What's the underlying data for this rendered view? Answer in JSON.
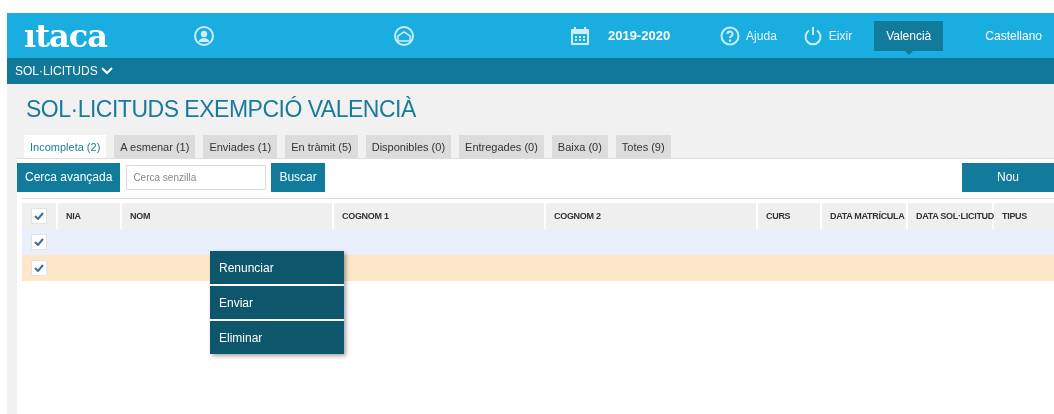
{
  "header": {
    "logo": "ıtaca",
    "year": "2019-2020",
    "help": "Ajuda",
    "exit": "Eixir",
    "languages": [
      {
        "label": "Valencià",
        "selected": true
      },
      {
        "label": "Castellano",
        "selected": false
      }
    ]
  },
  "subbar": {
    "menu": "SOL·LICITUDS"
  },
  "title": "SOL·LICITUDS EXEMPCIÓ VALENCIÀ",
  "tabs": [
    {
      "label": "Incompleta (2)",
      "selected": true
    },
    {
      "label": "A esmenar (1)",
      "selected": false
    },
    {
      "label": "Enviades (1)",
      "selected": false
    },
    {
      "label": "En tràmit (5)",
      "selected": false
    },
    {
      "label": "Disponibles (0)",
      "selected": false
    },
    {
      "label": "Entregades (0)",
      "selected": false
    },
    {
      "label": "Baixa (0)",
      "selected": false
    },
    {
      "label": "Totes (9)",
      "selected": false
    }
  ],
  "toolbar": {
    "advanced": "Cerca avançada",
    "search": {
      "placeholder": "Cerca senzilla"
    },
    "search_button": "Buscar",
    "new_button": "Nou"
  },
  "table": {
    "all_checked": true,
    "columns": [
      "NIA",
      "NOM",
      "COGNOM 1",
      "COGNOM 2",
      "CURS",
      "DATA MATRÍCULA",
      "DATA SOL·LICITUD",
      "TIPUS"
    ],
    "rows": [
      {
        "checked": true,
        "hovered": true,
        "selected": false
      },
      {
        "checked": true,
        "hovered": false,
        "selected": true
      }
    ]
  },
  "context_menu": [
    "Renunciar",
    "Enviar",
    "Eliminar"
  ]
}
